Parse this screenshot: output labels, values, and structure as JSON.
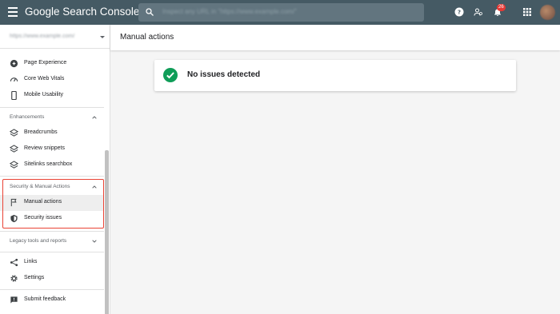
{
  "header": {
    "app_title": "Google Search Console",
    "search_placeholder": "Inspect any URL in \"https://www.example.com/\"",
    "notification_count": "26"
  },
  "property": {
    "selected": "https://www.example.com/"
  },
  "sidebar": {
    "items_top": [
      {
        "label": "Page Experience",
        "icon": "page-experience-icon"
      },
      {
        "label": "Core Web Vitals",
        "icon": "gauge-icon"
      },
      {
        "label": "Mobile Usability",
        "icon": "phone-icon"
      }
    ],
    "enhancements": {
      "heading": "Enhancements",
      "items": [
        {
          "label": "Breadcrumbs",
          "icon": "layers-icon"
        },
        {
          "label": "Review snippets",
          "icon": "layers-icon"
        },
        {
          "label": "Sitelinks searchbox",
          "icon": "layers-icon"
        }
      ]
    },
    "security": {
      "heading": "Security & Manual Actions",
      "items": [
        {
          "label": "Manual actions",
          "icon": "flag-icon",
          "active": true
        },
        {
          "label": "Security issues",
          "icon": "shield-icon"
        }
      ]
    },
    "legacy": {
      "heading": "Legacy tools and reports"
    },
    "items_bottom": [
      {
        "label": "Links",
        "icon": "links-icon"
      },
      {
        "label": "Settings",
        "icon": "gear-icon"
      }
    ],
    "feedback": {
      "label": "Submit feedback",
      "icon": "feedback-icon"
    }
  },
  "main": {
    "title": "Manual actions",
    "status_card": {
      "text": "No issues detected",
      "status_color": "#0f9d58"
    }
  },
  "colors": {
    "topbar": "#455a64",
    "highlight": "#ea4335"
  }
}
